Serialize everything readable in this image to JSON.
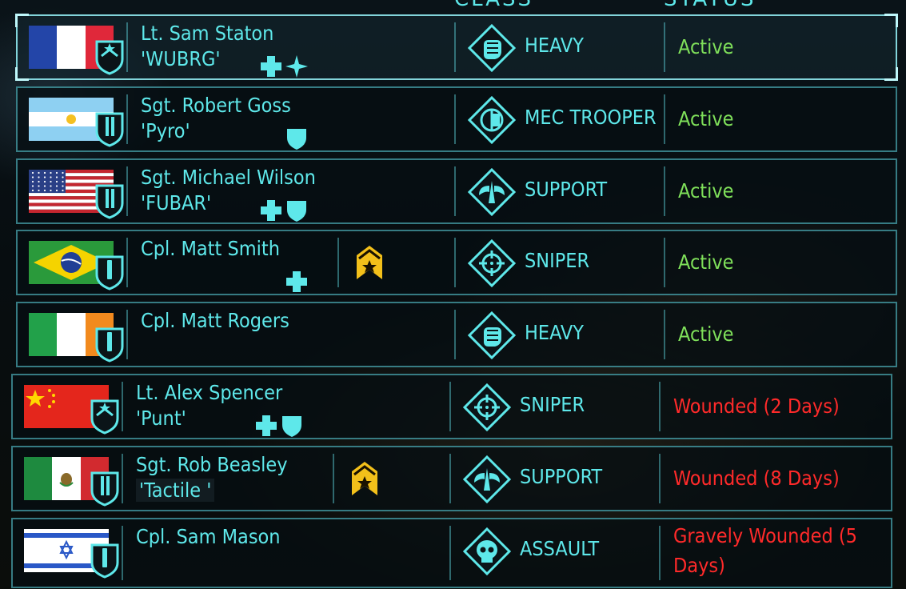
{
  "columns": {
    "class_header": "CLASS",
    "status_header": "STATUS"
  },
  "colors": {
    "accent": "#5ee8ea",
    "active": "#7fe05a",
    "wounded": "#ff2a2a",
    "rank_badge": "#f3c01a"
  },
  "soldiers": [
    {
      "flag": "france",
      "rank_icon": "lieutenant-icon",
      "name": "Lt. Sam Staton",
      "nickname": "'WUBRG'",
      "perks": [
        "medic-cross-icon",
        "star-cross-icon"
      ],
      "promotion": false,
      "class": "HEAVY",
      "class_icon": "heavy-fist-icon",
      "status": "Active",
      "status_type": "active"
    },
    {
      "flag": "argentina",
      "rank_icon": "sergeant-icon",
      "name": "Sgt. Robert Goss",
      "nickname": "'Pyro'",
      "perks": [
        "shield-icon"
      ],
      "promotion": false,
      "class": "MEC TROOPER",
      "class_icon": "mec-trooper-icon",
      "status": "Active",
      "status_type": "active"
    },
    {
      "flag": "usa",
      "rank_icon": "sergeant-icon",
      "name": "Sgt. Michael Wilson",
      "nickname": "'FUBAR'",
      "perks": [
        "medic-cross-icon",
        "shield-icon"
      ],
      "promotion": false,
      "class": "SUPPORT",
      "class_icon": "support-wings-icon",
      "status": "Active",
      "status_type": "active"
    },
    {
      "flag": "brazil",
      "rank_icon": "corporal-icon",
      "name": "Cpl. Matt Smith",
      "nickname": "",
      "perks": [
        "medic-cross-icon"
      ],
      "promotion": true,
      "class": "SNIPER",
      "class_icon": "sniper-crosshair-icon",
      "status": "Active",
      "status_type": "active"
    },
    {
      "flag": "ireland",
      "rank_icon": "corporal-icon",
      "name": "Cpl. Matt Rogers",
      "nickname": "",
      "perks": [],
      "promotion": false,
      "class": "HEAVY",
      "class_icon": "heavy-fist-icon",
      "status": "Active",
      "status_type": "active"
    },
    {
      "flag": "china",
      "rank_icon": "lieutenant-icon",
      "name": "Lt. Alex Spencer",
      "nickname": "'Punt'",
      "perks": [
        "medic-cross-icon",
        "shield-icon"
      ],
      "promotion": false,
      "class": "SNIPER",
      "class_icon": "sniper-crosshair-icon",
      "status": "Wounded (2 Days)",
      "status_type": "wounded"
    },
    {
      "flag": "mexico",
      "rank_icon": "sergeant-icon",
      "name": "Sgt. Rob Beasley",
      "nickname": "'Tactile '",
      "perks": [],
      "promotion": true,
      "class": "SUPPORT",
      "class_icon": "support-wings-icon",
      "status": "Wounded (8 Days)",
      "status_type": "wounded"
    },
    {
      "flag": "israel",
      "rank_icon": "corporal-icon",
      "name": "Cpl. Sam Mason",
      "nickname": "",
      "perks": [],
      "promotion": false,
      "class": "ASSAULT",
      "class_icon": "assault-skull-icon",
      "status": "Gravely Wounded (5 Days)",
      "status_type": "grave"
    }
  ]
}
